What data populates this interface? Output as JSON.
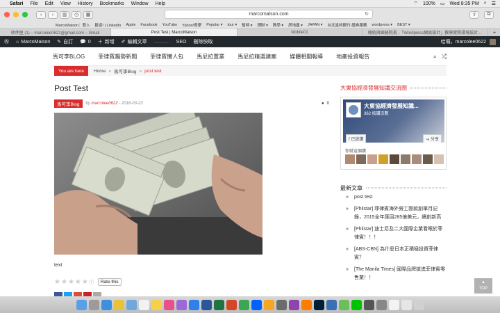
{
  "menubar": {
    "app": "Safari",
    "items": [
      "File",
      "Edit",
      "View",
      "History",
      "Bookmarks",
      "Window",
      "Help"
    ],
    "battery": "100%",
    "clock": "Wed 8:35 PM"
  },
  "browser": {
    "url": "marcomaison.com",
    "bookmarks": [
      "MarcoMaison：登入",
      "歡迎! | LinkedIn",
      "Apple",
      "Facebook",
      "YouTube",
      "Yahoo!奇摩",
      "Popular ▾",
      "tour ▾",
      "暫時 ▾",
      "理財 ▾",
      "教學 ▾",
      "房地產 ▾",
      "JAPAN ▾",
      "台北當邦銀行-證券服務",
      "wordpress ▾",
      "BEST ▾"
    ],
    "tabs": [
      {
        "label": "收件匣 (1) – marcolee0622@gmail.com – Gmail",
        "active": false
      },
      {
        "label": "Post Test | MarcoMaison",
        "active": true
      },
      {
        "label": "Mobile01",
        "active": false
      },
      {
        "label": "總統與國務院長 -「Wordpress網頁設計」教學實際環境設計...",
        "active": false
      }
    ]
  },
  "wpbar": {
    "site": "MarcoMaison",
    "customize": "自訂",
    "comments_count": "0",
    "new": "新增",
    "edit": "編輯文章",
    "seo": "SEO",
    "purge": "刪除快取",
    "greeting": "哈囉，marcolee0622"
  },
  "nav": {
    "items": [
      "馬可李BLOG",
      "菲律賓趨勢新聞",
      "菲律賓懶人包",
      "馬尼拉置業",
      "馬尼拉精選建案",
      "媒體相關報導",
      "地產投資報告"
    ]
  },
  "breadcrumb": {
    "here": "You are here",
    "home": "Home",
    "sep": "»",
    "parent": "馬可李Blog",
    "current": "post test"
  },
  "post": {
    "title": "Post Test",
    "category": "馬可李Blog",
    "by": "by",
    "author": "marcolee0622",
    "date": "- 2016-03-23",
    "comments": "0",
    "text": "text",
    "rate_label": "Rate this",
    "image_alt": "Hands counting US dollar bills"
  },
  "sidebar": {
    "fb_title": "大東協經濟發展知識交流圈",
    "fb_page_name": "大東協經濟發展知識...",
    "fb_likes": "362 按讚次數",
    "fb_liked": "已說讚",
    "fb_share": "分享",
    "fb_friends": "你就這個讚",
    "recent_title": "最新文章",
    "recent_posts": [
      "post test",
      "[Philstar] 菲律賓海外勞工匯款創單月記錄，2015全年匯回285億美元，續創新高",
      "[Philstar] 迪士尼及二大國際企業看眼於菲律賓！！！",
      "[ABS-CBN] 為什麼日本正積極投資菲律賓？",
      "[The Manila Times] 國際品牌搶進菲律賓零售業！！"
    ]
  },
  "top_button": "TOP",
  "colors": {
    "accent": "#d82d2d",
    "wpbar": "#23282d",
    "fb_blue": "#3b5998"
  }
}
